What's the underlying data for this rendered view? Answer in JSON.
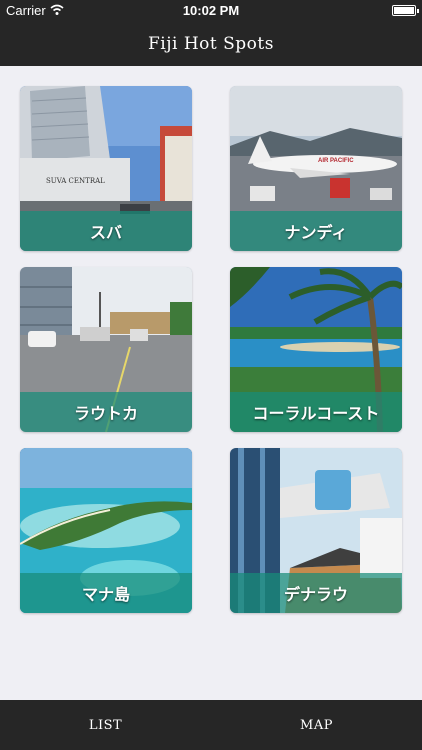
{
  "status_bar": {
    "carrier": "Carrier",
    "time": "10:02 PM"
  },
  "nav": {
    "title": "Fiji Hot Spots"
  },
  "spots": [
    {
      "label": "スバ"
    },
    {
      "label": "ナンディ"
    },
    {
      "label": "ラウトカ"
    },
    {
      "label": "コーラルコースト"
    },
    {
      "label": "マナ島"
    },
    {
      "label": "デナラウ"
    }
  ],
  "photo_text": {
    "building_sign": "SUVA CENTRAL",
    "airline": "AIR PACIFIC"
  },
  "tabs": [
    {
      "label": "LIST"
    },
    {
      "label": "MAP"
    }
  ],
  "colors": {
    "bar": "#262626",
    "background": "#efeff4",
    "label_overlay": "#188c78"
  }
}
